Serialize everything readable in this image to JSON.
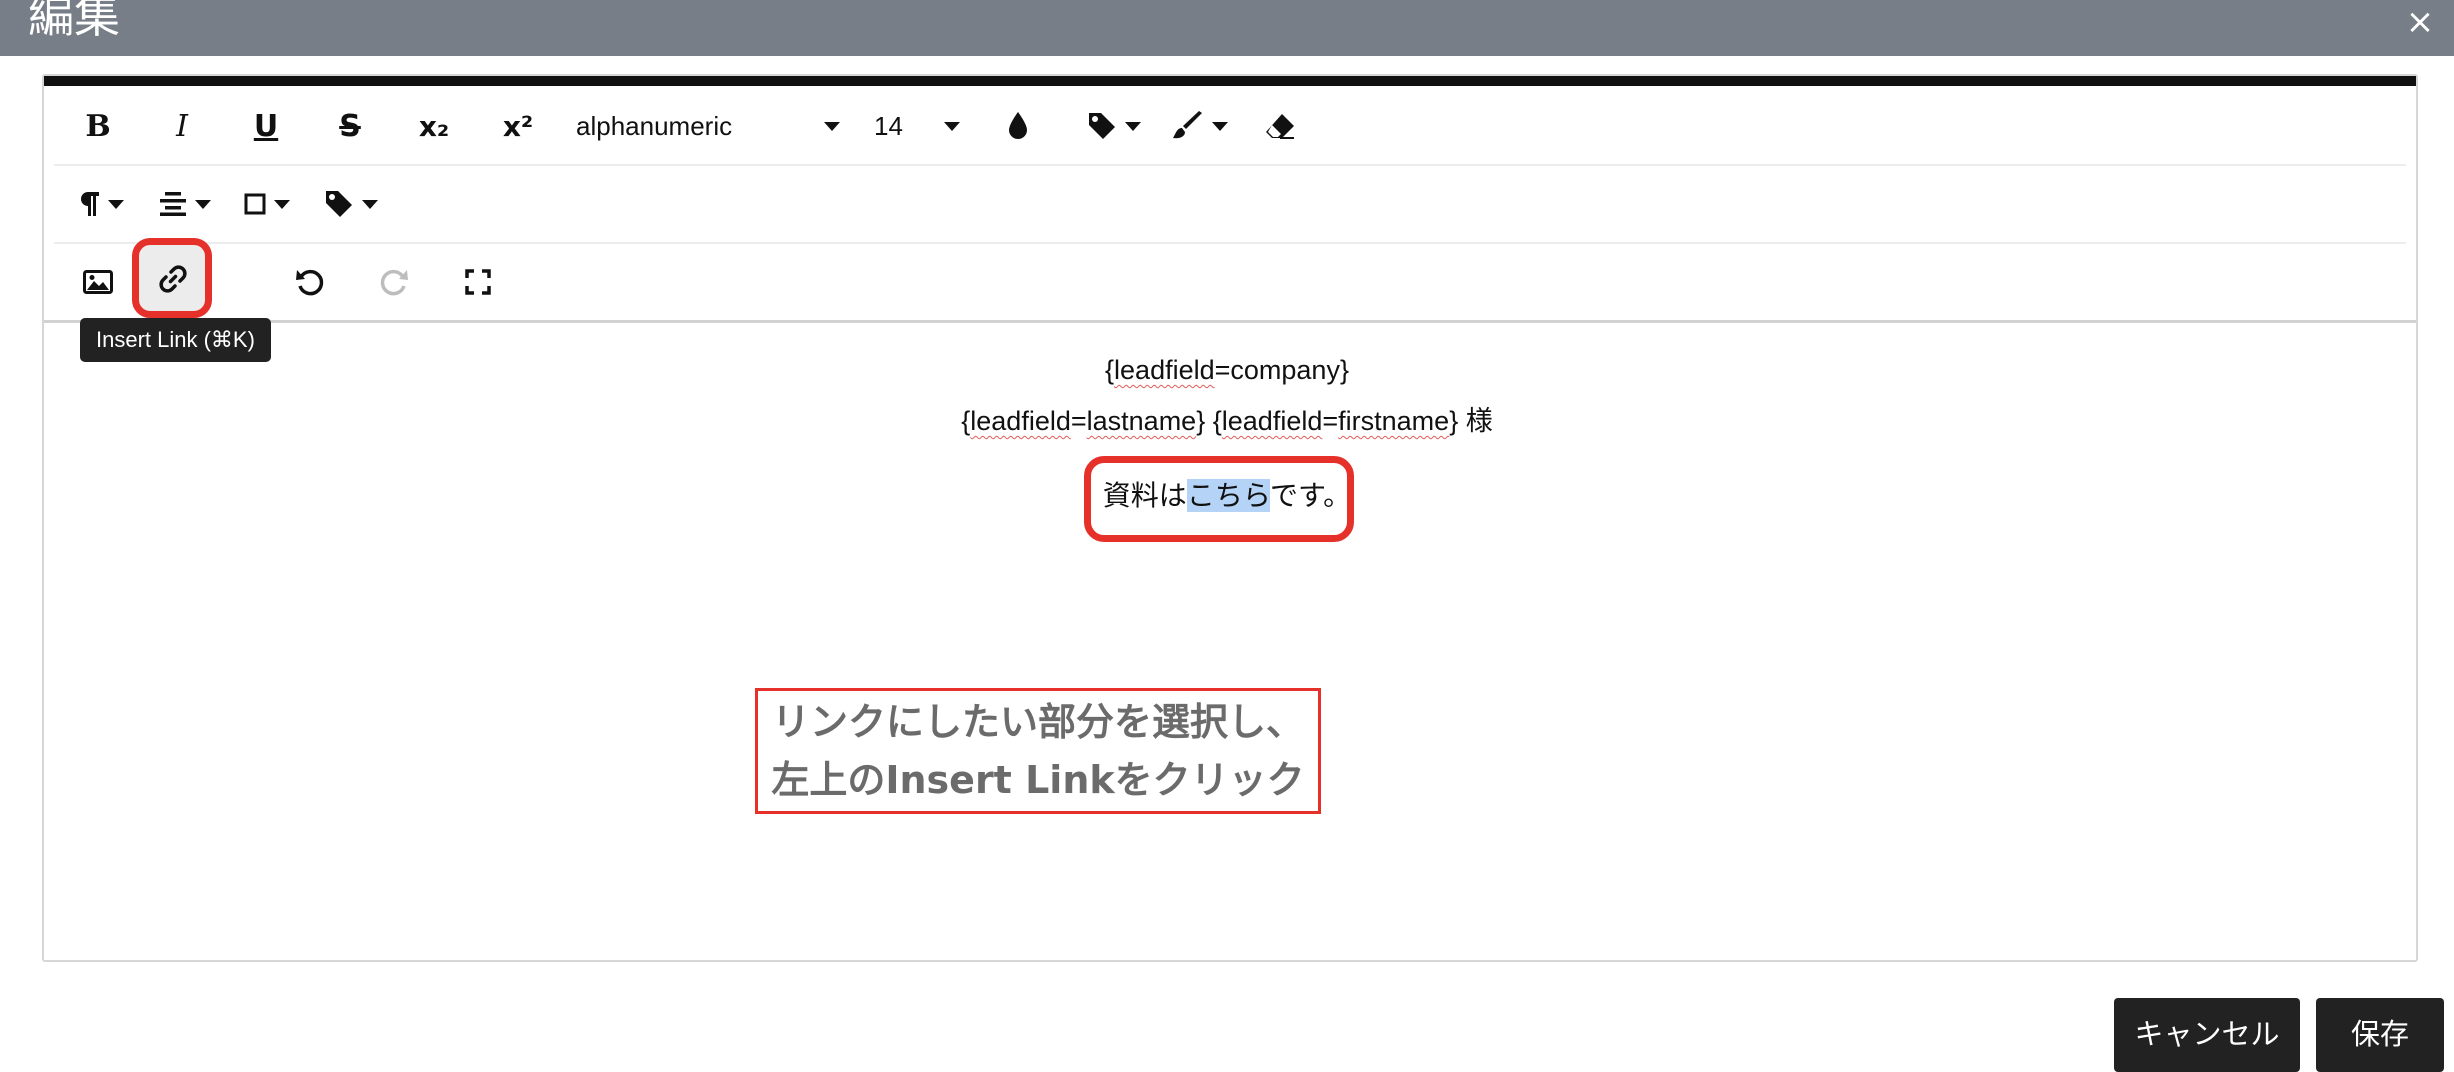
{
  "dialog": {
    "title": "編集",
    "close_symbol": "×"
  },
  "toolbar": {
    "bold_label": "B",
    "italic_label": "I",
    "underline_label": "U",
    "strike_label": "S",
    "subscript_label": "x₂",
    "superscript_label": "x²",
    "font_family": "alphanumeric",
    "font_size": "14",
    "tooltip": "Insert Link (⌘K)"
  },
  "content": {
    "line1_open": "{",
    "line1_word": "leadfield",
    "line1_rest": "=company}",
    "line2_a_open": "{",
    "line2_a_word": "leadfield",
    "line2_a_eq": "=",
    "line2_a_word2": "lastname",
    "line2_a_close": "}",
    "line2_space": " ",
    "line2_b_open": "{",
    "line2_b_word": "leadfield",
    "line2_b_eq": "=",
    "line2_b_word2": "firstname",
    "line2_b_close": "}",
    "line2_suffix": " 様",
    "line3_before": "資料は",
    "line3_selected": "こちら",
    "line3_after": "です。"
  },
  "annotation": {
    "line1": "リンクにしたい部分を選択し、",
    "line2": "左上のInsert Linkをクリック"
  },
  "footer": {
    "cancel_label": "キャンセル",
    "save_label": "保存"
  },
  "colors": {
    "header_bg": "#777e87",
    "highlight_red": "#e6302a",
    "selection_blue": "#b4d3f6",
    "button_bg": "#222222"
  }
}
